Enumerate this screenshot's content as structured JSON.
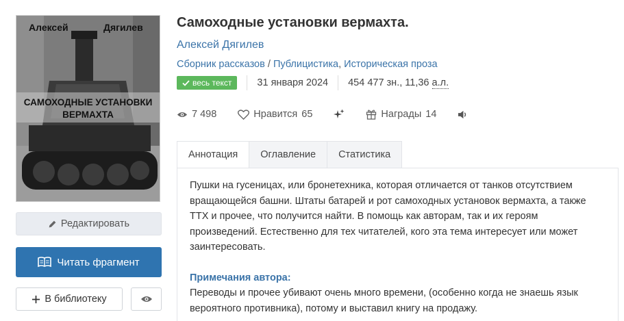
{
  "cover": {
    "author_first": "Алексей",
    "author_last": "Дягилев",
    "title_line1": "САМОХОДНЫЕ УСТАНОВКИ",
    "title_line2": "ВЕРМАХТА"
  },
  "actions": {
    "edit_label": "Редактировать",
    "read_label": "Читать фрагмент",
    "library_label": "В библиотеку"
  },
  "book": {
    "title": "Самоходные установки вермахта.",
    "author": "Алексей Дягилев",
    "genres": [
      "Сборник рассказов",
      "Публицистика",
      "Историческая проза"
    ],
    "genre_sep1": " / ",
    "genre_sep2": ", ",
    "badge": "весь текст",
    "date": "31 января 2024",
    "size_chars": "454 477 зн., 11,36",
    "size_unit": "а.л."
  },
  "stats": {
    "views": "7 498",
    "likes_label": "Нравится",
    "likes": "65",
    "awards_label": "Награды",
    "awards": "14"
  },
  "tabs": [
    "Аннотация",
    "Оглавление",
    "Статистика"
  ],
  "annotation": {
    "text": "Пушки на гусеницах, или бронетехника, которая отличается от танков отсутствием вращающейся башни. Штаты батарей и рот самоходных установок вермахта, а также ТТХ и прочее, что получится найти. В помощь как авторам, так и их героям произведений. Естественно для тех читателей, кого эта тема интересует или может заинтересовать.",
    "notes_heading": "Примечания автора:",
    "notes_text": "Переводы и прочее убивают очень много времени, (особенно когда не знаешь язык вероятного противника), потому и выставил книгу на продажу."
  },
  "colors": {
    "link": "#3a73a8",
    "primary_button": "#2f74b0",
    "badge": "#5cb85c"
  }
}
